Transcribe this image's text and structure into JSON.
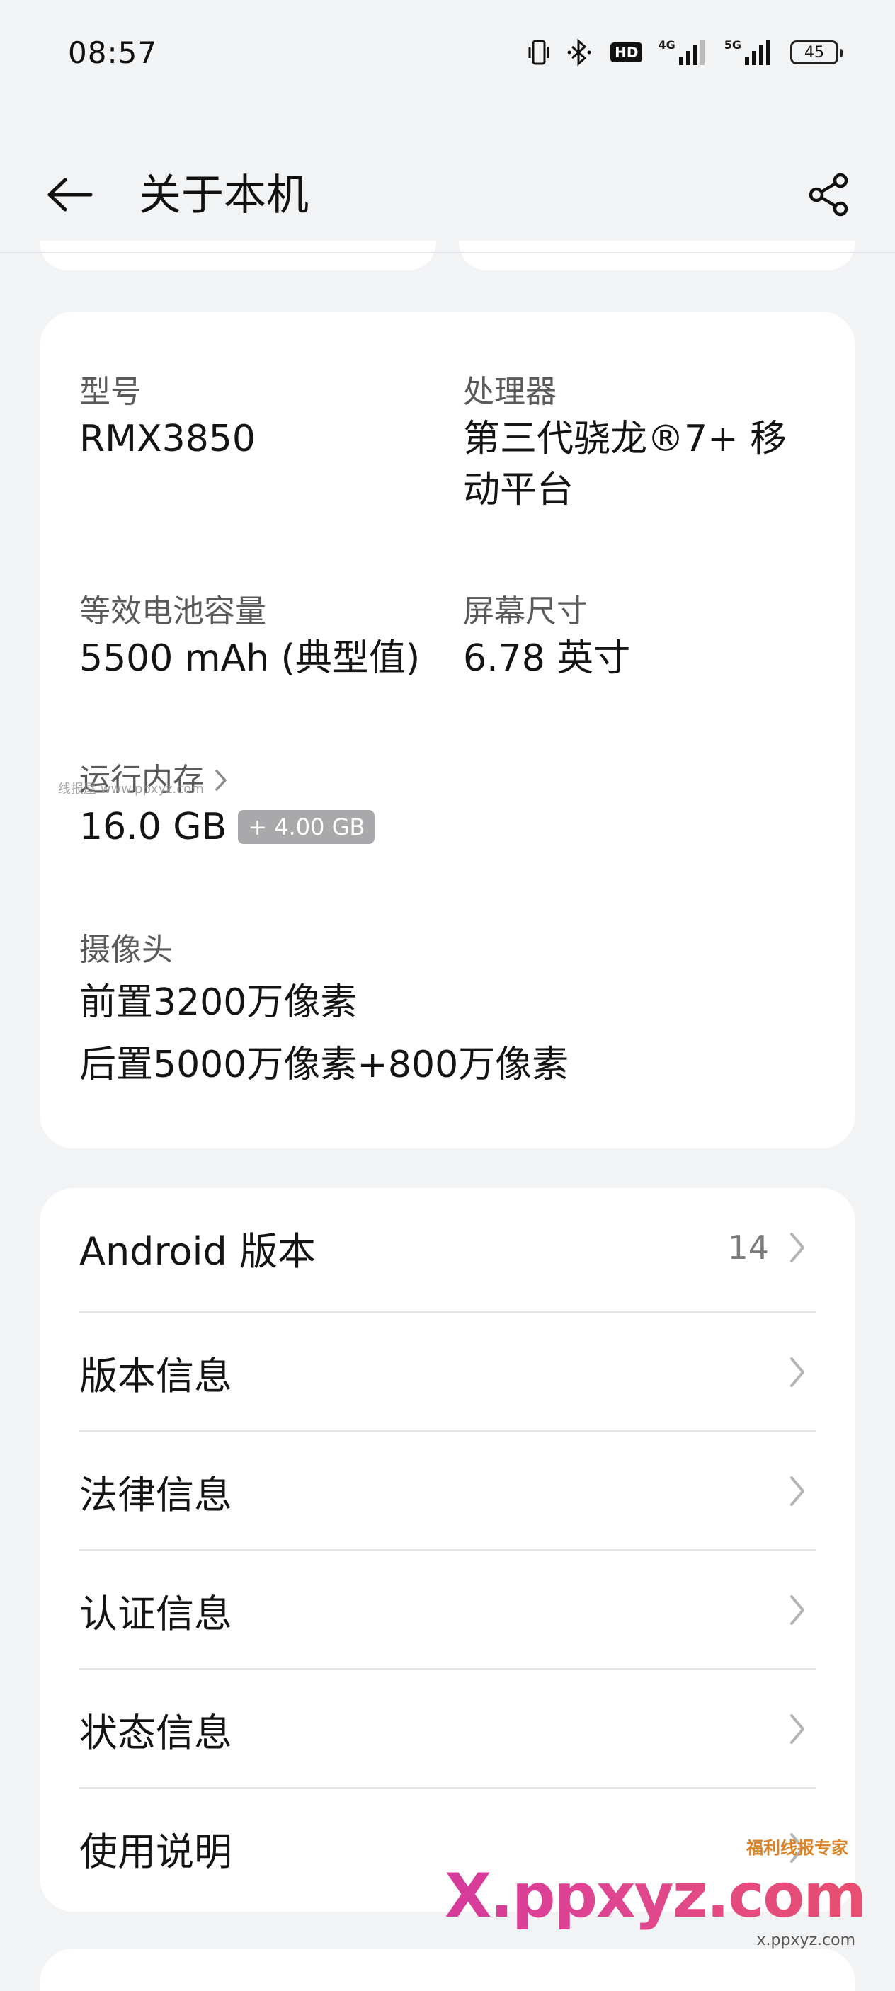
{
  "status_bar": {
    "time": "08:57",
    "hd_label": "HD",
    "network_1": "4G",
    "network_2": "5G",
    "battery": "45"
  },
  "header": {
    "title": "关于本机",
    "back_icon": "back-arrow-icon",
    "share_icon": "share-icon"
  },
  "specs": {
    "model": {
      "label": "型号",
      "value": "RMX3850"
    },
    "processor": {
      "label": "处理器",
      "value_line1": "第三代骁龙®7+ 移",
      "value_line2": "动平台"
    },
    "battery": {
      "label": "等效电池容量",
      "value": "5500 mAh (典型值)"
    },
    "screen": {
      "label": "屏幕尺寸",
      "value": "6.78 英寸"
    },
    "ram": {
      "label": "运行内存",
      "value": "16.0 GB",
      "badge": "+ 4.00 GB"
    },
    "camera": {
      "label": "摄像头",
      "front": "前置3200万像素",
      "rear": "后置5000万像素+800万像素"
    }
  },
  "settings_list": [
    {
      "label": "Android 版本",
      "value": "14"
    },
    {
      "label": "版本信息",
      "value": ""
    },
    {
      "label": "法律信息",
      "value": ""
    },
    {
      "label": "认证信息",
      "value": ""
    },
    {
      "label": "状态信息",
      "value": ""
    },
    {
      "label": "使用说明",
      "value": ""
    }
  ],
  "watermark": {
    "small": "线报屋 www.ppxyz.com",
    "brand": "X.ppxyz.com",
    "tag": "福利线报专家",
    "url": "x.ppxyz.com"
  },
  "colors": {
    "background": "#f2f3f5",
    "card": "#ffffff",
    "text_primary": "#141414",
    "text_secondary": "#5a5a5a",
    "badge": "#a9a9ab"
  }
}
